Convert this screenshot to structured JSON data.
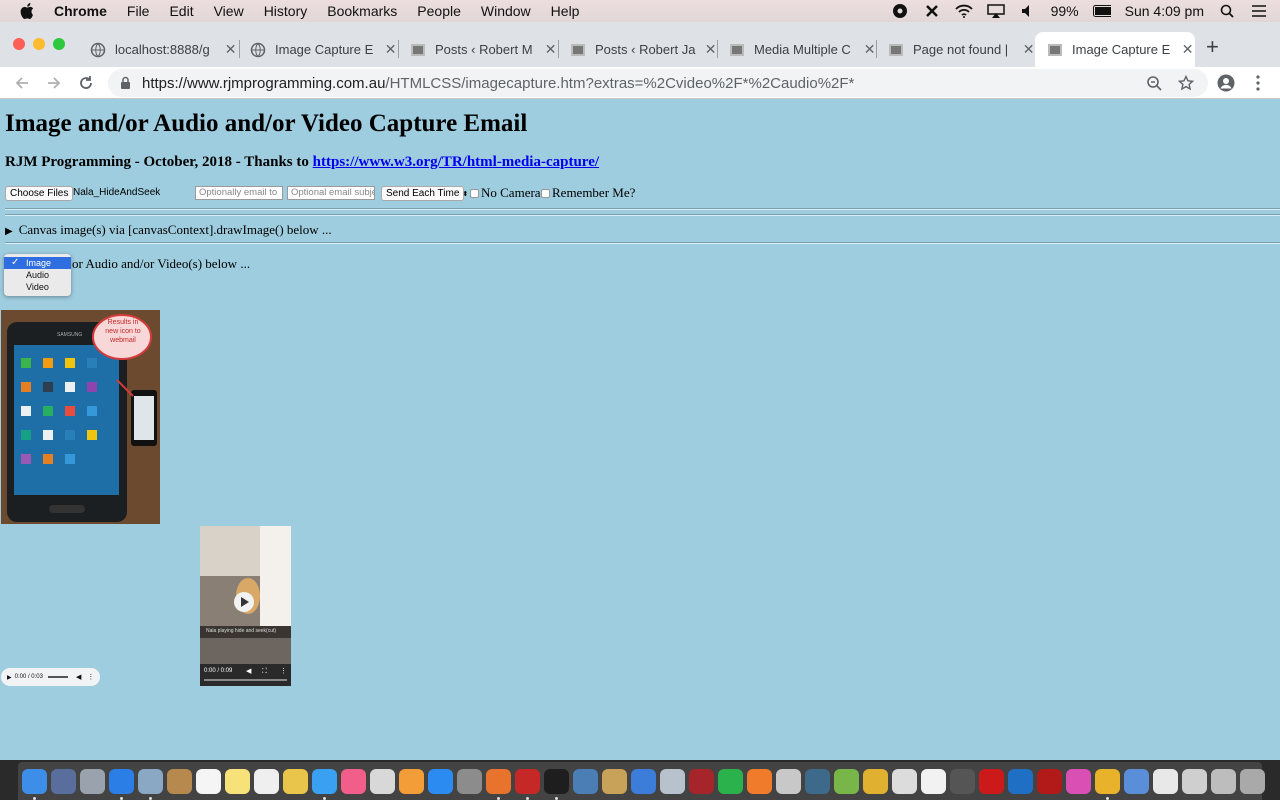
{
  "menubar": {
    "app_name": "Chrome",
    "items": [
      "File",
      "Edit",
      "View",
      "History",
      "Bookmarks",
      "People",
      "Window",
      "Help"
    ],
    "battery": "99%",
    "clock": "Sun 4:09 pm"
  },
  "tabs": [
    {
      "title": "localhost:8888/g"
    },
    {
      "title": "Image Capture E"
    },
    {
      "title": "Posts ‹ Robert M"
    },
    {
      "title": "Posts ‹ Robert Ja"
    },
    {
      "title": "Media Multiple C"
    },
    {
      "title": "Page not found |"
    },
    {
      "title": "Image Capture E"
    }
  ],
  "address_bar": {
    "host": "https://www.rjmprogramming.com.au",
    "path": "/HTMLCSS/imagecapture.htm?extras=%2Cvideo%2F*%2Caudio%2F*"
  },
  "page": {
    "title": "Image and/or Audio and/or Video Capture Email",
    "byline_text": "RJM Programming - October, 2018 - Thanks to ",
    "byline_link": "https://www.w3.org/TR/html-media-capture/",
    "choose_files_label": "Choose Files",
    "chosen_file": "Nala_HideAndSeek",
    "email_to_placeholder": "Optionally email to",
    "email_subject_placeholder": "Optional email subjec",
    "send_select": "Send Each Time",
    "no_camera_label": "No Camera",
    "remember_label": "Remember Me?",
    "canvas_summary": "Canvas image(s) via [canvasContext].drawImage() below ...",
    "media_summary_tail": "or Audio and/or Video(s) below ...",
    "media_options": [
      "Image",
      "Audio",
      "Video"
    ],
    "media_selected": "Image",
    "phone_bubble": "Results in new icon to webmail",
    "phone_brand": "SAMSUNG",
    "video_caption": "Nala playing hide and seek(cut)",
    "video_time": "0:00 / 0:09",
    "audio_time": "0:00 / 0:03"
  },
  "colors": {
    "page_bg": "#9ecddf",
    "link": "#0000ee",
    "selected_option": "#2f6ee0"
  }
}
